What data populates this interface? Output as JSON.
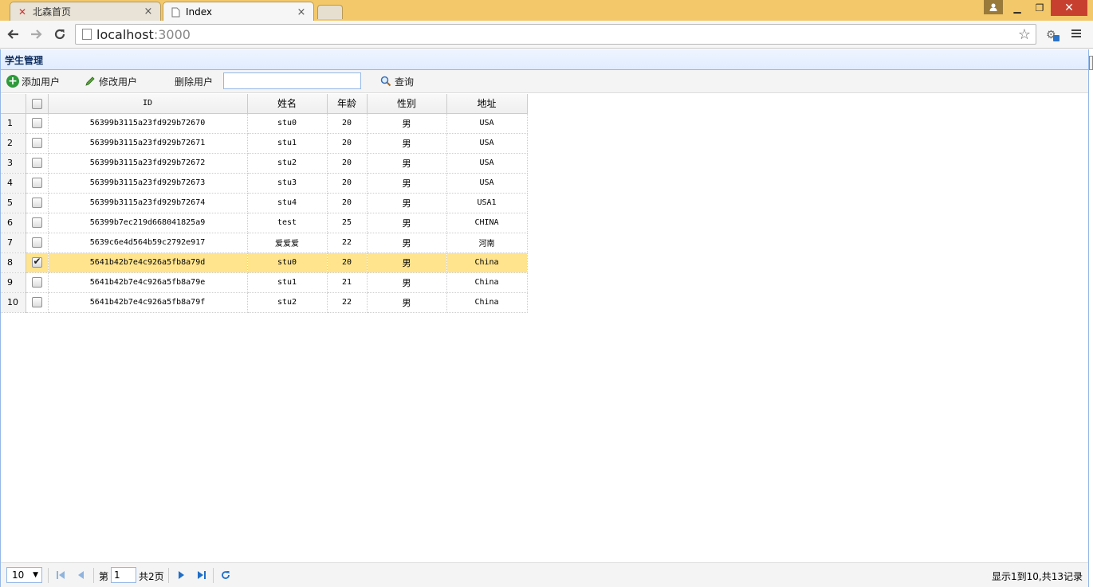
{
  "browser": {
    "tabs": [
      {
        "label": "北森首页",
        "active": false,
        "icon": "beisen-logo-icon"
      },
      {
        "label": "Index",
        "active": true,
        "icon": "page-icon"
      }
    ],
    "url_host": "localhost",
    "url_port": ":3000"
  },
  "panel": {
    "title": "学生管理"
  },
  "toolbar": {
    "add_label": "添加用户",
    "edit_label": "修改用户",
    "delete_label": "删除用户",
    "search_value": "",
    "search_label": "查询"
  },
  "grid": {
    "columns": [
      "ID",
      "姓名",
      "年龄",
      "性别",
      "地址"
    ],
    "rows": [
      {
        "num": "1",
        "id": "56399b3115a23fd929b72670",
        "name": "stu0",
        "age": "20",
        "gender": "男",
        "address": "USA",
        "checked": false
      },
      {
        "num": "2",
        "id": "56399b3115a23fd929b72671",
        "name": "stu1",
        "age": "20",
        "gender": "男",
        "address": "USA",
        "checked": false
      },
      {
        "num": "3",
        "id": "56399b3115a23fd929b72672",
        "name": "stu2",
        "age": "20",
        "gender": "男",
        "address": "USA",
        "checked": false
      },
      {
        "num": "4",
        "id": "56399b3115a23fd929b72673",
        "name": "stu3",
        "age": "20",
        "gender": "男",
        "address": "USA",
        "checked": false
      },
      {
        "num": "5",
        "id": "56399b3115a23fd929b72674",
        "name": "stu4",
        "age": "20",
        "gender": "男",
        "address": "USA1",
        "checked": false
      },
      {
        "num": "6",
        "id": "56399b7ec219d668041825a9",
        "name": "test",
        "age": "25",
        "gender": "男",
        "address": "CHINA",
        "checked": false
      },
      {
        "num": "7",
        "id": "5639c6e4d564b59c2792e917",
        "name": "爱爱爱",
        "age": "22",
        "gender": "男",
        "address": "河南",
        "checked": false
      },
      {
        "num": "8",
        "id": "5641b42b7e4c926a5fb8a79d",
        "name": "stu0",
        "age": "20",
        "gender": "男",
        "address": "China",
        "checked": true
      },
      {
        "num": "9",
        "id": "5641b42b7e4c926a5fb8a79e",
        "name": "stu1",
        "age": "21",
        "gender": "男",
        "address": "China",
        "checked": false
      },
      {
        "num": "10",
        "id": "5641b42b7e4c926a5fb8a79f",
        "name": "stu2",
        "age": "22",
        "gender": "男",
        "address": "China",
        "checked": false
      }
    ]
  },
  "pager": {
    "page_size": "10",
    "page_prefix": "第",
    "current_page": "1",
    "page_total": "共2页",
    "info": "显示1到10,共13记录"
  },
  "colors": {
    "selected_row": "#ffe48d",
    "panel_border": "#95b8e7",
    "titlebar": "#f3c86a"
  }
}
